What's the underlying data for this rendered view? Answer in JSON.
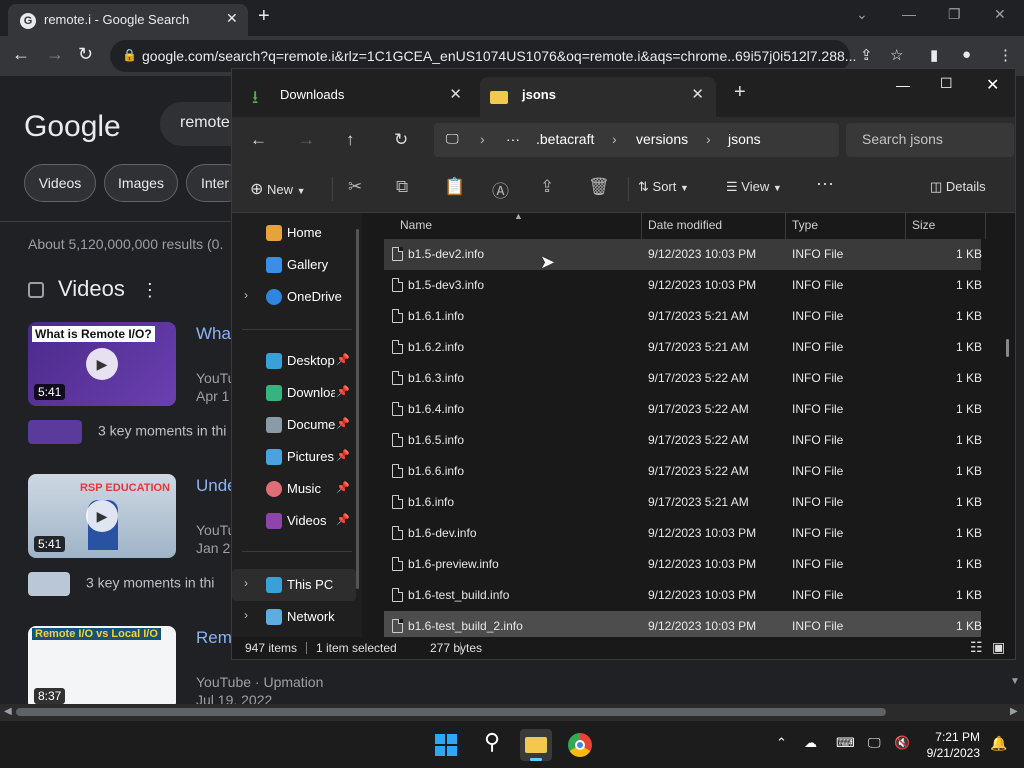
{
  "chrome": {
    "tab_title": "remote.i - Google Search",
    "new_tab_glyph": "+",
    "url": "google.com/search?q=remote.i&rlz=1C1GCEA_enUS1074US1076&oq=remote.i&aqs=chrome..69i57j0i512l7.288..."
  },
  "google": {
    "logo": "Google",
    "query": "remote",
    "chips": [
      "Videos",
      "Images",
      "Inter"
    ],
    "result_stats": "About 5,120,000,000 results (0.",
    "videos_heading": "Videos",
    "videos": [
      {
        "thumb_title": "What is Remote I/O?",
        "duration": "5:41",
        "title": "What",
        "source": "YouTu",
        "date": "Apr 1",
        "key_moments": "3 key moments in thi"
      },
      {
        "thumb_title": "RSP EDUCATION",
        "duration": "5:41",
        "title": "Unde",
        "source": "YouTu",
        "date": "Jan 2",
        "key_moments": "3 key moments in thi"
      },
      {
        "thumb_title": "Remote I/O vs Local I/O",
        "duration": "8:37",
        "title": "Remo",
        "source": "YouTube",
        "source_channel": "· Upmation",
        "date": "Jul 19, 2022"
      }
    ]
  },
  "explorer": {
    "tabs": [
      {
        "label": "Downloads"
      },
      {
        "label": "jsons"
      }
    ],
    "path": [
      ".betacraft",
      "versions",
      "jsons"
    ],
    "search_placeholder": "Search jsons",
    "commands": {
      "new": "New",
      "sort": "Sort",
      "view": "View",
      "details": "Details"
    },
    "nav": [
      {
        "label": "Home",
        "color": "#e6a23c"
      },
      {
        "label": "Gallery",
        "color": "#3a8ee6"
      },
      {
        "label": "OneDrive",
        "color": "#2e86de",
        "chevron": true
      },
      {
        "label": "Desktop",
        "color": "#3aa0d8",
        "pinned": true
      },
      {
        "label": "Downloads",
        "color": "#36b37e",
        "pinned": true
      },
      {
        "label": "Documents",
        "color": "#8a9ba8",
        "pinned": true
      },
      {
        "label": "Pictures",
        "color": "#4aa3df",
        "pinned": true
      },
      {
        "label": "Music",
        "color": "#e06c75",
        "pinned": true
      },
      {
        "label": "Videos",
        "color": "#8e44ad",
        "pinned": true
      },
      {
        "label": "This PC",
        "color": "#3aa0d8",
        "chevron": true
      },
      {
        "label": "Network",
        "color": "#5dade2",
        "chevron": true
      }
    ],
    "columns": {
      "name": "Name",
      "date": "Date modified",
      "type": "Type",
      "size": "Size"
    },
    "files": [
      {
        "name": "b1.5-dev2.info",
        "date": "9/12/2023 10:03 PM",
        "type": "INFO File",
        "size": "1 KB",
        "state": "hover"
      },
      {
        "name": "b1.5-dev3.info",
        "date": "9/12/2023 10:03 PM",
        "type": "INFO File",
        "size": "1 KB"
      },
      {
        "name": "b1.6.1.info",
        "date": "9/17/2023 5:21 AM",
        "type": "INFO File",
        "size": "1 KB"
      },
      {
        "name": "b1.6.2.info",
        "date": "9/17/2023 5:21 AM",
        "type": "INFO File",
        "size": "1 KB"
      },
      {
        "name": "b1.6.3.info",
        "date": "9/17/2023 5:22 AM",
        "type": "INFO File",
        "size": "1 KB"
      },
      {
        "name": "b1.6.4.info",
        "date": "9/17/2023 5:22 AM",
        "type": "INFO File",
        "size": "1 KB"
      },
      {
        "name": "b1.6.5.info",
        "date": "9/17/2023 5:22 AM",
        "type": "INFO File",
        "size": "1 KB"
      },
      {
        "name": "b1.6.6.info",
        "date": "9/17/2023 5:22 AM",
        "type": "INFO File",
        "size": "1 KB"
      },
      {
        "name": "b1.6.info",
        "date": "9/17/2023 5:21 AM",
        "type": "INFO File",
        "size": "1 KB"
      },
      {
        "name": "b1.6-dev.info",
        "date": "9/12/2023 10:03 PM",
        "type": "INFO File",
        "size": "1 KB"
      },
      {
        "name": "b1.6-preview.info",
        "date": "9/12/2023 10:03 PM",
        "type": "INFO File",
        "size": "1 KB"
      },
      {
        "name": "b1.6-test_build.info",
        "date": "9/12/2023 10:03 PM",
        "type": "INFO File",
        "size": "1 KB"
      },
      {
        "name": "b1.6-test_build_2.info",
        "date": "9/12/2023 10:03 PM",
        "type": "INFO File",
        "size": "1 KB",
        "state": "selected"
      }
    ],
    "status": {
      "items": "947 items",
      "selected": "1 item selected",
      "size": "277 bytes"
    }
  },
  "taskbar": {
    "time": "7:21 PM",
    "date": "9/21/2023"
  }
}
